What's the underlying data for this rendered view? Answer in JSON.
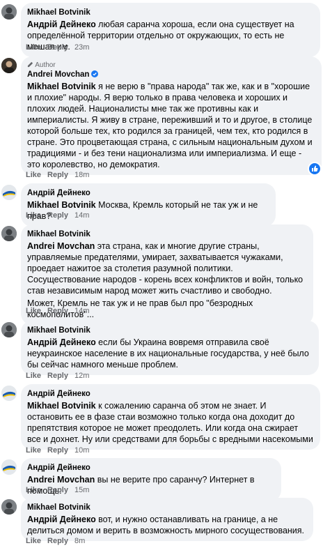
{
  "colors": {
    "bubble": "#f0f2f5",
    "meta_text": "#65676b",
    "like_blue": "#1877f2",
    "verified_blue": "#1877f2",
    "name_text": "#050505"
  },
  "actions": {
    "like": "Like",
    "reply": "Reply"
  },
  "comments": [
    {
      "author": "Mikhael Botvinik",
      "mention": "Андрій Дейнеко",
      "text": " любая саранча хороша, если она существует на определённой территории отдельно от окружающих, то есть не мешая им.",
      "time": "23m"
    },
    {
      "author_badge": "Author",
      "author": "Andrei Movchan",
      "mention": "Mikhael Botvinik",
      "text": " я не верю в \"права народа\" так же, как и в \"хорошие и плохие\" народы. Я верю только в права человека и хороших и плохих людей. Националисты мне так же противны как и империалисты. Я живу в стране, переживший и то и другое, в столице которой больше тех, кто родился за границей, чем тех, кто родился в стране. Это процветающая страна, с сильным национальным духом и традициями - и без тени национализма или империализма. И еще - это королевство, но демократия.",
      "time": "18m",
      "reaction_icon": "like-icon"
    },
    {
      "author": "Андрій Дейнеко",
      "mention": "Mikhael Botvinik",
      "text": " Москва, Кремль который не так уж и не прав?",
      "time": "14m"
    },
    {
      "author": "Mikhael Botvinik",
      "mention": "Andrei Movchan",
      "text": " эта страна, как и многие другие страны, управляемые предателями, умирает, захватывается чужаками, проедает нажитое за столетия разумной политики. Сосуществование народов - корень всех конфликтов и войн, только став независимым народ может жить счастливо и свободно.",
      "text2": "Может, Кремль не так уж и не прав был про \"безродных космополитов\"...",
      "time": "14m"
    },
    {
      "author": "Mikhael Botvinik",
      "mention": "Андрій Дейнеко",
      "text": " если бы Украина вовремя отправила своё неукраинское население в их национальные государства, у неё было бы сейчас намного меньше проблем.",
      "time": "12m"
    },
    {
      "author": "Андрій Дейнеко",
      "mention": "Mikhael Botvinik",
      "text": " к сожалению саранча об этом не знает. И остановить ее в фазе стаи возможно только когда она доходит до препятствия которое не может преодолеть. Или когда она сжирает все и дохнет. Ну или средствами для борьбы с вредными насекомыми",
      "time": "10m"
    },
    {
      "author": "Андрій Дейнеко",
      "mention": "Andrei Movchan",
      "text": " вы не верите про саранчу? Интернет в помощь.",
      "time": "15m"
    },
    {
      "author": "Mikhael Botvinik",
      "mention": "Андрій Дейнеко",
      "text": " вот, и нужно останавливать на границе, а не делиться домом и верить в возможность мирного сосуществования.",
      "time": "8m"
    }
  ]
}
